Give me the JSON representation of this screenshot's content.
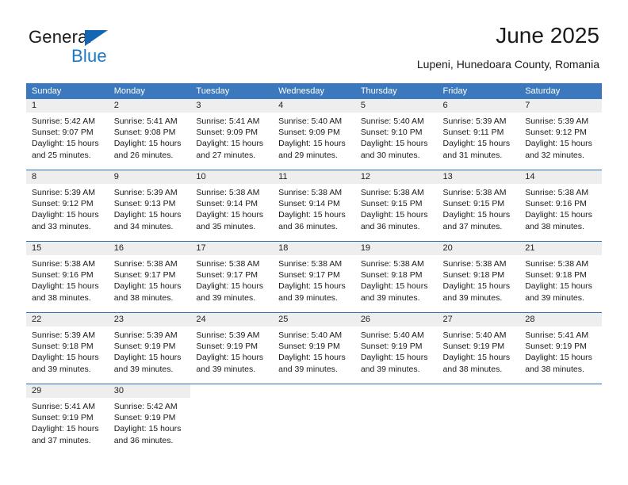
{
  "brand": {
    "name_part1": "General",
    "name_part2": "Blue",
    "flag_icon": "triangle-flag-icon",
    "accent_color": "#1979c9"
  },
  "header": {
    "title": "June 2025",
    "location": "Lupeni, Hunedoara County, Romania"
  },
  "theme": {
    "header_bg": "#3b78bd",
    "row_divider": "#2f6cb0",
    "daynum_bg": "#eeeeee",
    "text": "#1a1a1a"
  },
  "calendar": {
    "weekday_headers": [
      "Sunday",
      "Monday",
      "Tuesday",
      "Wednesday",
      "Thursday",
      "Friday",
      "Saturday"
    ],
    "weeks": [
      [
        {
          "day": "1",
          "sunrise": "Sunrise: 5:42 AM",
          "sunset": "Sunset: 9:07 PM",
          "daylight_line1": "Daylight: 15 hours",
          "daylight_line2": "and 25 minutes."
        },
        {
          "day": "2",
          "sunrise": "Sunrise: 5:41 AM",
          "sunset": "Sunset: 9:08 PM",
          "daylight_line1": "Daylight: 15 hours",
          "daylight_line2": "and 26 minutes."
        },
        {
          "day": "3",
          "sunrise": "Sunrise: 5:41 AM",
          "sunset": "Sunset: 9:09 PM",
          "daylight_line1": "Daylight: 15 hours",
          "daylight_line2": "and 27 minutes."
        },
        {
          "day": "4",
          "sunrise": "Sunrise: 5:40 AM",
          "sunset": "Sunset: 9:09 PM",
          "daylight_line1": "Daylight: 15 hours",
          "daylight_line2": "and 29 minutes."
        },
        {
          "day": "5",
          "sunrise": "Sunrise: 5:40 AM",
          "sunset": "Sunset: 9:10 PM",
          "daylight_line1": "Daylight: 15 hours",
          "daylight_line2": "and 30 minutes."
        },
        {
          "day": "6",
          "sunrise": "Sunrise: 5:39 AM",
          "sunset": "Sunset: 9:11 PM",
          "daylight_line1": "Daylight: 15 hours",
          "daylight_line2": "and 31 minutes."
        },
        {
          "day": "7",
          "sunrise": "Sunrise: 5:39 AM",
          "sunset": "Sunset: 9:12 PM",
          "daylight_line1": "Daylight: 15 hours",
          "daylight_line2": "and 32 minutes."
        }
      ],
      [
        {
          "day": "8",
          "sunrise": "Sunrise: 5:39 AM",
          "sunset": "Sunset: 9:12 PM",
          "daylight_line1": "Daylight: 15 hours",
          "daylight_line2": "and 33 minutes."
        },
        {
          "day": "9",
          "sunrise": "Sunrise: 5:39 AM",
          "sunset": "Sunset: 9:13 PM",
          "daylight_line1": "Daylight: 15 hours",
          "daylight_line2": "and 34 minutes."
        },
        {
          "day": "10",
          "sunrise": "Sunrise: 5:38 AM",
          "sunset": "Sunset: 9:14 PM",
          "daylight_line1": "Daylight: 15 hours",
          "daylight_line2": "and 35 minutes."
        },
        {
          "day": "11",
          "sunrise": "Sunrise: 5:38 AM",
          "sunset": "Sunset: 9:14 PM",
          "daylight_line1": "Daylight: 15 hours",
          "daylight_line2": "and 36 minutes."
        },
        {
          "day": "12",
          "sunrise": "Sunrise: 5:38 AM",
          "sunset": "Sunset: 9:15 PM",
          "daylight_line1": "Daylight: 15 hours",
          "daylight_line2": "and 36 minutes."
        },
        {
          "day": "13",
          "sunrise": "Sunrise: 5:38 AM",
          "sunset": "Sunset: 9:15 PM",
          "daylight_line1": "Daylight: 15 hours",
          "daylight_line2": "and 37 minutes."
        },
        {
          "day": "14",
          "sunrise": "Sunrise: 5:38 AM",
          "sunset": "Sunset: 9:16 PM",
          "daylight_line1": "Daylight: 15 hours",
          "daylight_line2": "and 38 minutes."
        }
      ],
      [
        {
          "day": "15",
          "sunrise": "Sunrise: 5:38 AM",
          "sunset": "Sunset: 9:16 PM",
          "daylight_line1": "Daylight: 15 hours",
          "daylight_line2": "and 38 minutes."
        },
        {
          "day": "16",
          "sunrise": "Sunrise: 5:38 AM",
          "sunset": "Sunset: 9:17 PM",
          "daylight_line1": "Daylight: 15 hours",
          "daylight_line2": "and 38 minutes."
        },
        {
          "day": "17",
          "sunrise": "Sunrise: 5:38 AM",
          "sunset": "Sunset: 9:17 PM",
          "daylight_line1": "Daylight: 15 hours",
          "daylight_line2": "and 39 minutes."
        },
        {
          "day": "18",
          "sunrise": "Sunrise: 5:38 AM",
          "sunset": "Sunset: 9:17 PM",
          "daylight_line1": "Daylight: 15 hours",
          "daylight_line2": "and 39 minutes."
        },
        {
          "day": "19",
          "sunrise": "Sunrise: 5:38 AM",
          "sunset": "Sunset: 9:18 PM",
          "daylight_line1": "Daylight: 15 hours",
          "daylight_line2": "and 39 minutes."
        },
        {
          "day": "20",
          "sunrise": "Sunrise: 5:38 AM",
          "sunset": "Sunset: 9:18 PM",
          "daylight_line1": "Daylight: 15 hours",
          "daylight_line2": "and 39 minutes."
        },
        {
          "day": "21",
          "sunrise": "Sunrise: 5:38 AM",
          "sunset": "Sunset: 9:18 PM",
          "daylight_line1": "Daylight: 15 hours",
          "daylight_line2": "and 39 minutes."
        }
      ],
      [
        {
          "day": "22",
          "sunrise": "Sunrise: 5:39 AM",
          "sunset": "Sunset: 9:18 PM",
          "daylight_line1": "Daylight: 15 hours",
          "daylight_line2": "and 39 minutes."
        },
        {
          "day": "23",
          "sunrise": "Sunrise: 5:39 AM",
          "sunset": "Sunset: 9:19 PM",
          "daylight_line1": "Daylight: 15 hours",
          "daylight_line2": "and 39 minutes."
        },
        {
          "day": "24",
          "sunrise": "Sunrise: 5:39 AM",
          "sunset": "Sunset: 9:19 PM",
          "daylight_line1": "Daylight: 15 hours",
          "daylight_line2": "and 39 minutes."
        },
        {
          "day": "25",
          "sunrise": "Sunrise: 5:40 AM",
          "sunset": "Sunset: 9:19 PM",
          "daylight_line1": "Daylight: 15 hours",
          "daylight_line2": "and 39 minutes."
        },
        {
          "day": "26",
          "sunrise": "Sunrise: 5:40 AM",
          "sunset": "Sunset: 9:19 PM",
          "daylight_line1": "Daylight: 15 hours",
          "daylight_line2": "and 39 minutes."
        },
        {
          "day": "27",
          "sunrise": "Sunrise: 5:40 AM",
          "sunset": "Sunset: 9:19 PM",
          "daylight_line1": "Daylight: 15 hours",
          "daylight_line2": "and 38 minutes."
        },
        {
          "day": "28",
          "sunrise": "Sunrise: 5:41 AM",
          "sunset": "Sunset: 9:19 PM",
          "daylight_line1": "Daylight: 15 hours",
          "daylight_line2": "and 38 minutes."
        }
      ],
      [
        {
          "day": "29",
          "sunrise": "Sunrise: 5:41 AM",
          "sunset": "Sunset: 9:19 PM",
          "daylight_line1": "Daylight: 15 hours",
          "daylight_line2": "and 37 minutes."
        },
        {
          "day": "30",
          "sunrise": "Sunrise: 5:42 AM",
          "sunset": "Sunset: 9:19 PM",
          "daylight_line1": "Daylight: 15 hours",
          "daylight_line2": "and 36 minutes."
        },
        {
          "day": "",
          "sunrise": "",
          "sunset": "",
          "daylight_line1": "",
          "daylight_line2": ""
        },
        {
          "day": "",
          "sunrise": "",
          "sunset": "",
          "daylight_line1": "",
          "daylight_line2": ""
        },
        {
          "day": "",
          "sunrise": "",
          "sunset": "",
          "daylight_line1": "",
          "daylight_line2": ""
        },
        {
          "day": "",
          "sunrise": "",
          "sunset": "",
          "daylight_line1": "",
          "daylight_line2": ""
        },
        {
          "day": "",
          "sunrise": "",
          "sunset": "",
          "daylight_line1": "",
          "daylight_line2": ""
        }
      ]
    ]
  }
}
